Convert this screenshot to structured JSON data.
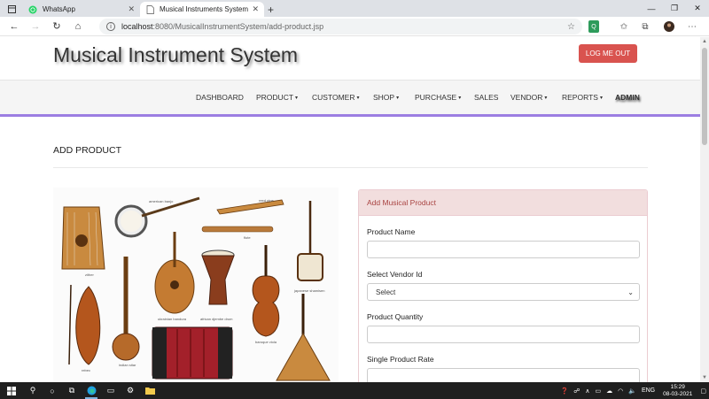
{
  "browser": {
    "tabs": [
      {
        "title": "WhatsApp",
        "active": false
      },
      {
        "title": "Musical Instruments System",
        "active": true
      }
    ],
    "new_tab": "+",
    "url_host": "localhost",
    "url_path": ":8080/MusicalInstrumentSystem/add-product.jsp"
  },
  "header": {
    "site_title": "Musical Instrument System",
    "logout_label": "LOG ME OUT"
  },
  "nav": {
    "items": [
      {
        "label": "DASHBOARD",
        "dropdown": false
      },
      {
        "label": "PRODUCT",
        "dropdown": true
      },
      {
        "label": "CUSTOMER",
        "dropdown": true
      },
      {
        "label": "SHOP",
        "dropdown": true
      },
      {
        "label": "PURCHASE",
        "dropdown": true
      },
      {
        "label": "SALES",
        "dropdown": false
      },
      {
        "label": "VENDOR",
        "dropdown": true
      },
      {
        "label": "REPORTS",
        "dropdown": true
      },
      {
        "label": "ADMIN",
        "dropdown": false
      }
    ]
  },
  "main": {
    "page_title": "ADD PRODUCT",
    "image_labels": {
      "zither": "zither",
      "american_banjo": "american banjo",
      "reed_pipe": "reed pipe",
      "flute": "flute",
      "ukrainian_bandura": "ukrainian bandura",
      "african_djembe_drum": "african djembe drum",
      "japanese_shamisen": "japanese shamisen",
      "indian_sitar": "indian sitar",
      "baroque_viola": "baroque viola",
      "rebec": "rebec"
    },
    "form": {
      "panel_title": "Add Musical Product",
      "product_name_label": "Product Name",
      "product_name_value": "",
      "vendor_label": "Select Vendor Id",
      "vendor_selected": "Select",
      "quantity_label": "Product Quantity",
      "quantity_value": "",
      "rate_label": "Single Product Rate",
      "rate_value": ""
    }
  },
  "taskbar": {
    "language": "ENG",
    "time": "15:29",
    "date": "08-03-2021"
  }
}
